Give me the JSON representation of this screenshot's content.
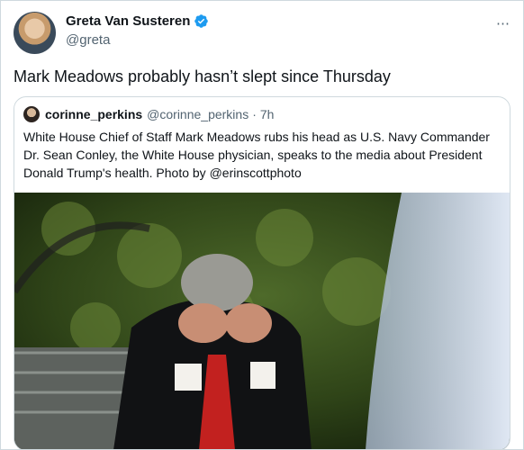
{
  "author": {
    "name": "Greta Van Susteren",
    "handle": "@greta",
    "more_icon": "⋯"
  },
  "tweet": {
    "text": "Mark Meadows probably hasn’t slept since Thursday"
  },
  "quoted": {
    "name": "corinne_perkins",
    "handle": "@corinne_perkins",
    "separator": "·",
    "time": "7h",
    "text": "White House Chief of Staff Mark Meadows rubs his head as U.S. Navy Commander Dr. Sean Conley, the White House physician, speaks to the media about President Donald Trump's health. Photo by @erinscottphoto"
  },
  "colors": {
    "verified": "#1d9bf0",
    "text": "#0f1419",
    "secondary": "#536471",
    "border": "#cfd9de"
  }
}
